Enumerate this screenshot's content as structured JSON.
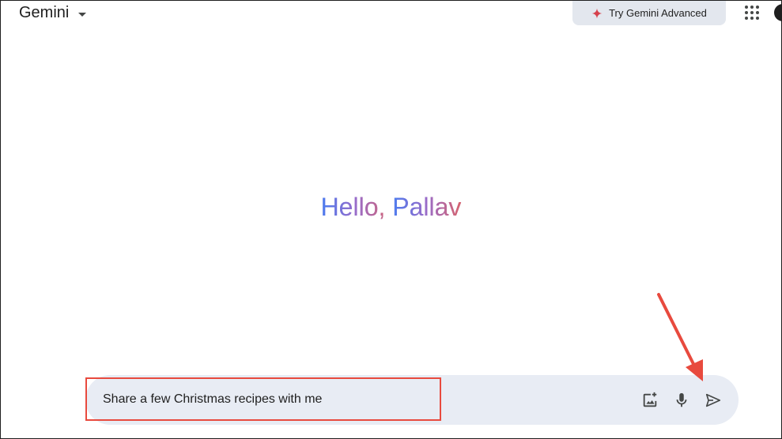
{
  "header": {
    "app_title": "Gemini",
    "advanced_label": "Try Gemini Advanced"
  },
  "main": {
    "greeting_prefix": "Hello, ",
    "greeting_name": "Pallav"
  },
  "prompt": {
    "value": "Share a few Christmas recipes with me"
  },
  "colors": {
    "accent_red": "#e84a3e",
    "prompt_bg": "#e8ecf4",
    "greeting_blue": "#4b7df0",
    "greeting_pink": "#d8646c"
  },
  "icons": [
    "chevron-down-icon",
    "sparkle-icon",
    "apps-grid-icon",
    "add-image-icon",
    "microphone-icon",
    "send-icon"
  ]
}
